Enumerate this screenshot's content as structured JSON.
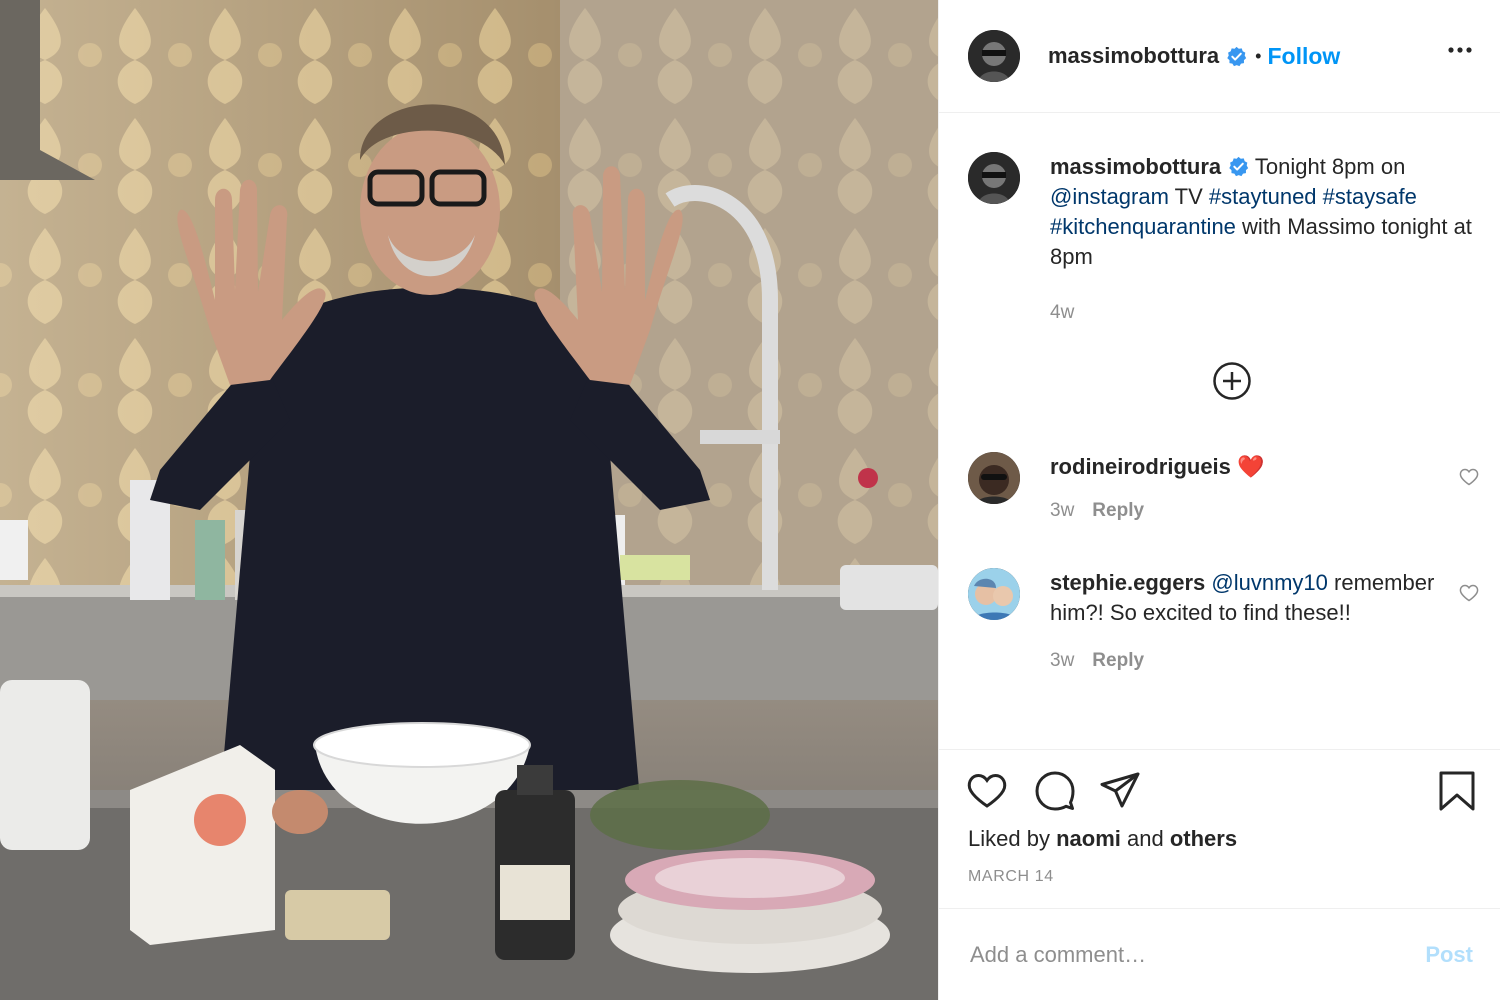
{
  "post": {
    "author": "massimobottura",
    "follow_label": "Follow",
    "separator": "•",
    "caption": {
      "text_before": "Tonight 8pm on",
      "mention": "@instagram",
      "text_mid": "TV",
      "hashtags": [
        "#staytuned",
        "#staysafe",
        "#kitchenquarantine"
      ],
      "text_after": "with Massimo tonight at 8pm",
      "age": "4w"
    },
    "comments": [
      {
        "user": "rodineirodrigueis",
        "text": "❤️",
        "age": "3w",
        "reply_label": "Reply"
      },
      {
        "user": "stephie.eggers",
        "mention": "@luvnmy10",
        "text": "remember him?! So excited to find these!!",
        "age": "3w",
        "reply_label": "Reply"
      }
    ],
    "likes": {
      "prefix": "Liked by",
      "user": "naomi",
      "conj": "and",
      "rest": "others"
    },
    "date": "MARCH 14",
    "comment_placeholder": "Add a comment…",
    "post_label": "Post",
    "colors": {
      "accent": "#0095f6",
      "link": "#00376b",
      "muted": "#8e8e8e",
      "post_disabled": "#b2dffc",
      "heart": "#ed4956"
    },
    "icons": [
      "verified-badge-icon",
      "more-options-icon",
      "load-more-plus-icon",
      "heart-icon",
      "comment-icon",
      "share-icon",
      "bookmark-icon"
    ]
  }
}
